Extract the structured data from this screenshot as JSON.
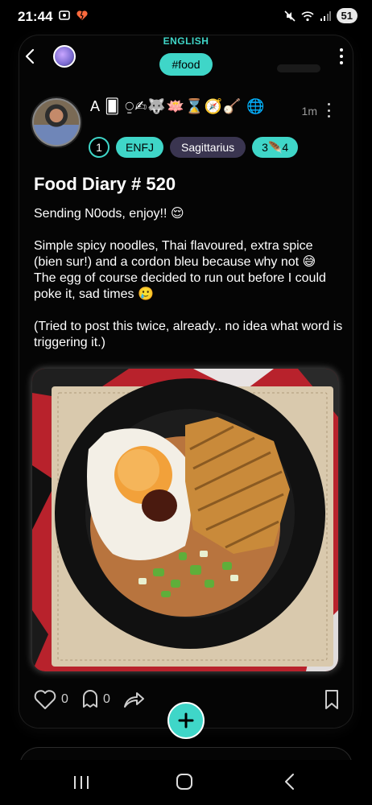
{
  "status_bar": {
    "time": "21:44",
    "battery": "51",
    "left_icons": [
      "screenshot-icon",
      "heart-broken-icon"
    ],
    "right_icons": [
      "mute-icon",
      "wifi-icon",
      "signal-icon"
    ]
  },
  "header": {
    "language": "ENGLISH",
    "tag": "#food",
    "back_icon": "chevron-left-icon",
    "more_icon": "vertical-dots-icon"
  },
  "author": {
    "name": "A 🂠 ⍜✍🐺🪷⌛🧭🪕 🌐",
    "time": "1m"
  },
  "badges": {
    "level": "1",
    "mbti": "ENFJ",
    "zodiac": "Sagittarius",
    "extra": "3🪶4"
  },
  "post": {
    "title": "Food Diary # 520",
    "line1": "Sending N0ods, enjoy!! 😌",
    "line2": "Simple spicy noodles, Thai flavoured, extra spice (bien sur!) and a cordon bleu because why not 😅",
    "line3": "The egg of course decided to run out before I could poke it, sad times 🥲",
    "line4": "(Tried to post this twice, already.. no idea what word is triggering it.)",
    "image_description_icon": "food-photo-icon"
  },
  "actions": {
    "likes": "0",
    "comments": "0"
  },
  "colors": {
    "accent": "#3fd6c8",
    "background": "#000000",
    "zodiac_chip": "#3a3550"
  }
}
